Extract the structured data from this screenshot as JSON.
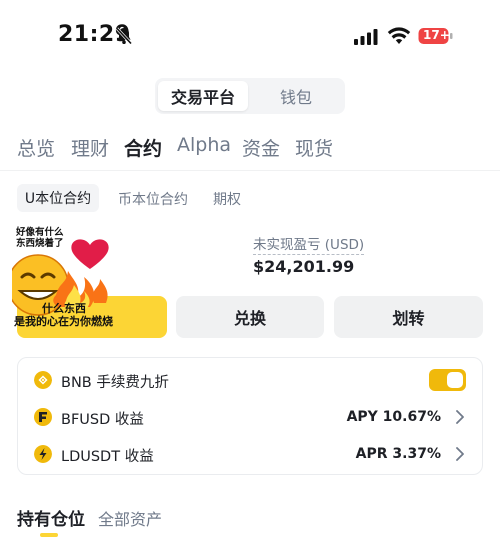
{
  "status_bar": {
    "time": "21:29",
    "battery": "17+"
  },
  "top_switch": {
    "active": "交易平台",
    "inactive": "钱包"
  },
  "main_tabs": [
    {
      "label": "总览",
      "active": false
    },
    {
      "label": "理财",
      "active": false
    },
    {
      "label": "合约",
      "active": true
    },
    {
      "label": "Alpha",
      "active": false
    },
    {
      "label": "资金",
      "active": false
    },
    {
      "label": "现货",
      "active": false
    }
  ],
  "sub_tabs": [
    {
      "label": "U本位合约",
      "active": true
    },
    {
      "label": "币本位合约",
      "active": false
    },
    {
      "label": "期权",
      "active": false
    }
  ],
  "pnl": {
    "label": "未实现盈亏 (USD)",
    "value": "$24,201.99"
  },
  "buttons": {
    "exchange": "兑换",
    "transfer": "划转"
  },
  "meme": {
    "top_line1": "好像有什么",
    "top_line2": "东西烧着了",
    "mid": "什么东西",
    "bottom": "是我的心在为你燃烧"
  },
  "card": {
    "rows": [
      {
        "label": "BNB 手续费九折",
        "icon": "bnb-coin-icon",
        "toggle_on": true
      },
      {
        "label": "BFUSD 收益",
        "value": "APY 10.67%",
        "icon": "bfusd-coin-icon"
      },
      {
        "label": "LDUSDT 收益",
        "value": "APR 3.37%",
        "icon": "ldusdt-coin-icon"
      }
    ]
  },
  "bottom_tabs": {
    "active": "持有仓位",
    "inactive": "全部资产"
  },
  "colors": {
    "accent": "#fcd535",
    "toggle": "#f0b90b",
    "text": "#1e2026",
    "muted": "#707a8a",
    "battery": "#ef4444"
  }
}
